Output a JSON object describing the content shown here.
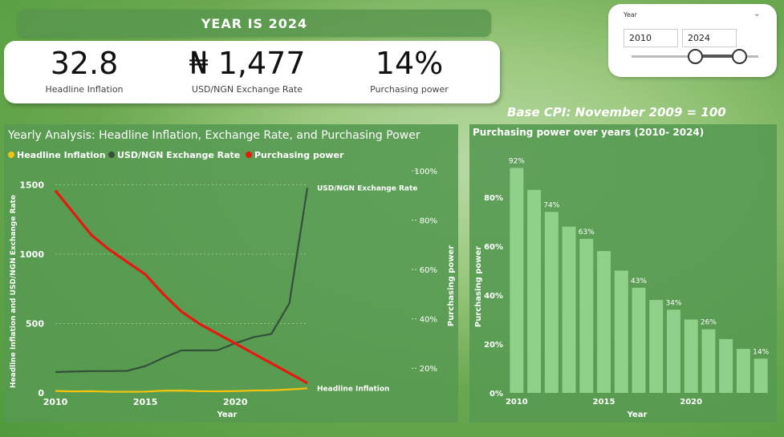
{
  "banner": {
    "title": "YEAR IS 2024"
  },
  "kpis": [
    {
      "value": "32.8",
      "label": "Headline Inflation"
    },
    {
      "value": "₦ 1,477",
      "label": "USD/NGN Exchange Rate"
    },
    {
      "value": "14%",
      "label": "Purchasing power"
    }
  ],
  "slicer": {
    "title": "Year",
    "start": "2010",
    "end": "2024",
    "range": [
      2010,
      2024
    ],
    "selected": [
      2010,
      2024
    ]
  },
  "base_cpi": "Base CPI: November 2009 = 100",
  "colors": {
    "inflation": "#f2c40f",
    "exchange": "#33503a",
    "purchasing": "#e8180e",
    "bars": "#8fd18b"
  },
  "chart_data": [
    {
      "type": "line",
      "title": "Yearly Analysis: Headline Inflation, Exchange Rate, and Purchasing Power",
      "xlabel": "Year",
      "ylabel": "Headline Inflation and USD/NGN Exchange Rate",
      "y2label": "Purchasing power",
      "legend_position": "top-left",
      "x": [
        2010,
        2011,
        2012,
        2013,
        2014,
        2015,
        2016,
        2017,
        2018,
        2019,
        2020,
        2021,
        2022,
        2023,
        2024
      ],
      "xticks": [
        "2010",
        "2015",
        "2020"
      ],
      "ylim": [
        0,
        1600
      ],
      "yticks": [
        "0",
        "500",
        "1000",
        "1500"
      ],
      "y2lim": [
        10,
        100
      ],
      "y2ticks": [
        "20%",
        "40%",
        "60%",
        "80%",
        "100%"
      ],
      "series": [
        {
          "name": "Headline Inflation",
          "axis": "left",
          "color": "#f2c40f",
          "values": [
            13.7,
            10.8,
            12.2,
            8.5,
            8.1,
            9.0,
            15.7,
            16.5,
            12.1,
            11.4,
            13.2,
            17.0,
            18.8,
            24.7,
            32.8
          ],
          "end_label": "Headline Inflation"
        },
        {
          "name": "USD/NGN Exchange Rate",
          "axis": "left",
          "color": "#33503a",
          "values": [
            150,
            154,
            157,
            157,
            159,
            193,
            253,
            306,
            306,
            307,
            358,
            401,
            425,
            645,
            1477
          ],
          "end_label": "USD/NGN Exchange Rate"
        },
        {
          "name": "Purchasing power",
          "axis": "right",
          "color": "#e8180e",
          "values": [
            92,
            83,
            74,
            68,
            63,
            58,
            50,
            43,
            38,
            34,
            30,
            26,
            22,
            18,
            14
          ]
        }
      ],
      "grid": true
    },
    {
      "type": "bar",
      "title": "Purchasing power over years (2010- 2024)",
      "xlabel": "Year",
      "ylabel": "Purchasing power",
      "categories": [
        2010,
        2011,
        2012,
        2013,
        2014,
        2015,
        2016,
        2017,
        2018,
        2019,
        2020,
        2021,
        2022,
        2023,
        2024
      ],
      "xticks": [
        "2010",
        "2015",
        "2020"
      ],
      "values": [
        92,
        83,
        74,
        68,
        63,
        58,
        50,
        43,
        38,
        34,
        30,
        26,
        22,
        18,
        14
      ],
      "data_labels": [
        "92%",
        "",
        "74%",
        "",
        "63%",
        "",
        "",
        "43%",
        "",
        "34%",
        "",
        "26%",
        "",
        "",
        "14%"
      ],
      "ylim": [
        0,
        100
      ],
      "yticks": [
        "0%",
        "20%",
        "40%",
        "60%",
        "80%"
      ],
      "grid": false
    }
  ]
}
